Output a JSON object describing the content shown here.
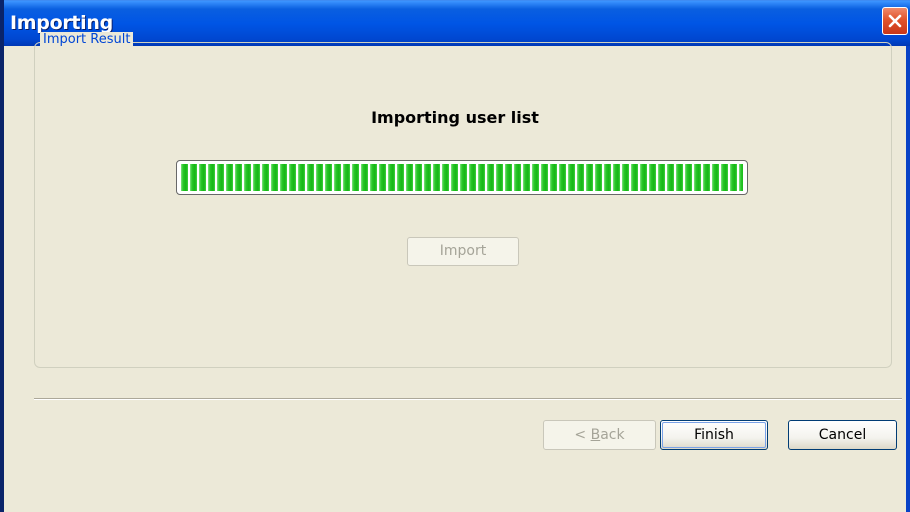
{
  "window": {
    "title": "Importing"
  },
  "group": {
    "legend": "Import Result",
    "heading": "Importing user list"
  },
  "progress": {
    "fraction": 1.0
  },
  "buttons": {
    "import_label": "Import",
    "back_prefix": "< ",
    "back_accel": "B",
    "back_rest": "ack",
    "finish_label": "Finish",
    "cancel_label": "Cancel"
  },
  "icons": {
    "close": "close-icon"
  },
  "colors": {
    "title_bar": "#0055e5",
    "progress_fill": "#14b514",
    "legend_text": "#0046d5",
    "close_button": "#e0542c"
  }
}
